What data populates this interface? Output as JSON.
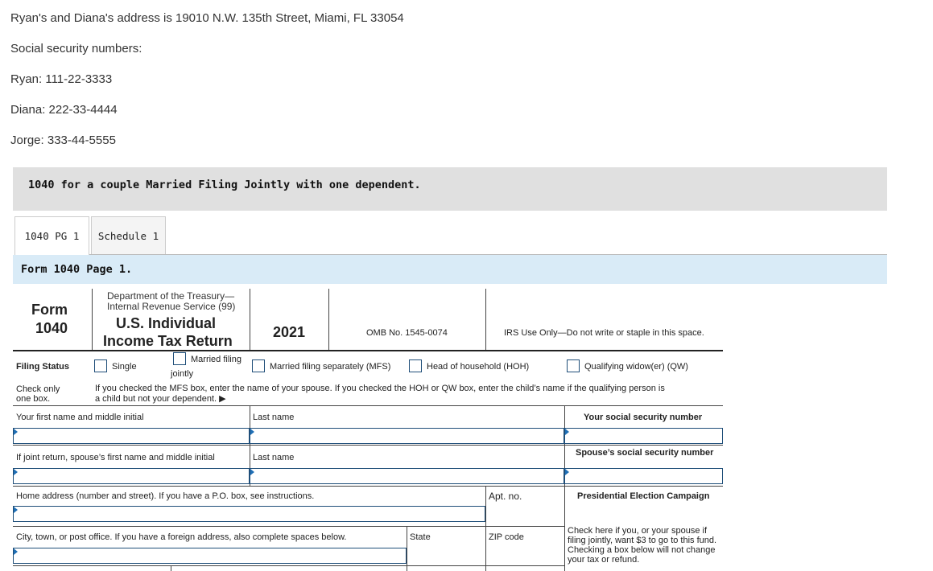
{
  "info": {
    "address": "Ryan's and Diana's address is 19010 N.W. 135th Street, Miami, FL 33054",
    "ssn_heading": "Social security numbers:",
    "ryan": "Ryan: 111-22-3333",
    "diana": "Diana: 222-33-4444",
    "jorge": "Jorge: 333-44-5555"
  },
  "banner": "1040 for a couple Married Filing Jointly with one dependent.",
  "tabs": [
    {
      "label": "1040 PG 1",
      "active": true
    },
    {
      "label": "Schedule 1",
      "active": false
    }
  ],
  "page_title": "Form 1040 Page 1.",
  "form": {
    "form_label": "Form",
    "form_number": "1040",
    "dept_line1": "Department of the Treasury—",
    "dept_line2": "Internal Revenue Service (99)",
    "title_line1": "U.S. Individual",
    "title_line2": "Income Tax Return",
    "year": "2021",
    "omb": "OMB No. 1545-0074",
    "irs_use": "IRS Use Only—Do not write or staple in this space.",
    "filing_status": "Filing Status",
    "check_only_1": "Check only",
    "check_only_2": "one box.",
    "options": {
      "single": "Single",
      "mfj_1": "Married filing",
      "mfj_2": "jointly",
      "mfs": "Married filing separately (MFS)",
      "hoh": "Head of household (HOH)",
      "qw": "Qualifying widow(er) (QW)"
    },
    "mfs_note_1": "If you checked the MFS box, enter the name of your spouse. If you checked the HOH or QW box, enter the child’s name if the qualifying person is",
    "mfs_note_2": "a child but not your dependent. ▶",
    "first_name_label": "Your first name and middle initial",
    "last_name_label": "Last name",
    "ssn_label": "Your social security number",
    "spouse_first_label": "If joint return, spouse’s first name and middle initial",
    "spouse_last_label": "Last name",
    "spouse_ssn_label": "Spouse’s social security number",
    "home_address_label": "Home address (number and street). If you have a P.O. box, see instructions.",
    "apt_label": "Apt. no.",
    "pec_label": "Presidential Election Campaign",
    "city_label": "City, town, or post office. If you have a foreign address, also complete spaces below.",
    "state_label": "State",
    "zip_label": "ZIP code",
    "pec_text_1": "Check here if you, or your spouse if",
    "pec_text_2": "filing jointly, want $3 to go to this fund.",
    "pec_text_3": "Checking a box below will not change",
    "pec_text_4": "your tax or refund."
  }
}
